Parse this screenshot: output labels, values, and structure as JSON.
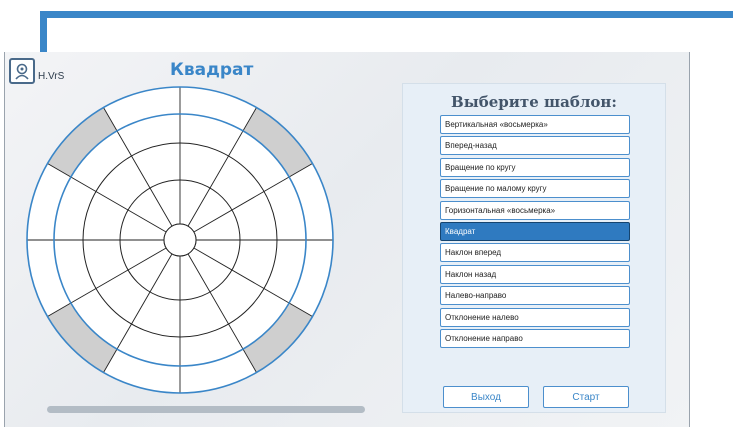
{
  "app": {
    "logo_text": "H.VrS",
    "title": "Квадрат"
  },
  "colors": {
    "accent": "#3a86c8",
    "selected": "#2f7ac0",
    "sector_fill": "#cfcfcf"
  },
  "target": {
    "highlighted_sectors": [
      "upper-left",
      "upper-right",
      "lower-left",
      "lower-right"
    ]
  },
  "panel": {
    "title": "Выберите шаблон:",
    "templates": [
      {
        "label": "Вертикальная «восьмерка»",
        "selected": false
      },
      {
        "label": "Вперед-назад",
        "selected": false
      },
      {
        "label": "Вращение по кругу",
        "selected": false
      },
      {
        "label": "Вращение по малому кругу",
        "selected": false
      },
      {
        "label": "Горизонтальная «восьмерка»",
        "selected": false
      },
      {
        "label": "Квадрат",
        "selected": true
      },
      {
        "label": "Наклон вперед",
        "selected": false
      },
      {
        "label": "Наклон назад",
        "selected": false
      },
      {
        "label": "Налево-направо",
        "selected": false
      },
      {
        "label": "Отклонение налево",
        "selected": false
      },
      {
        "label": "Отклонение направо",
        "selected": false
      }
    ],
    "exit_label": "Выход",
    "start_label": "Старт"
  }
}
